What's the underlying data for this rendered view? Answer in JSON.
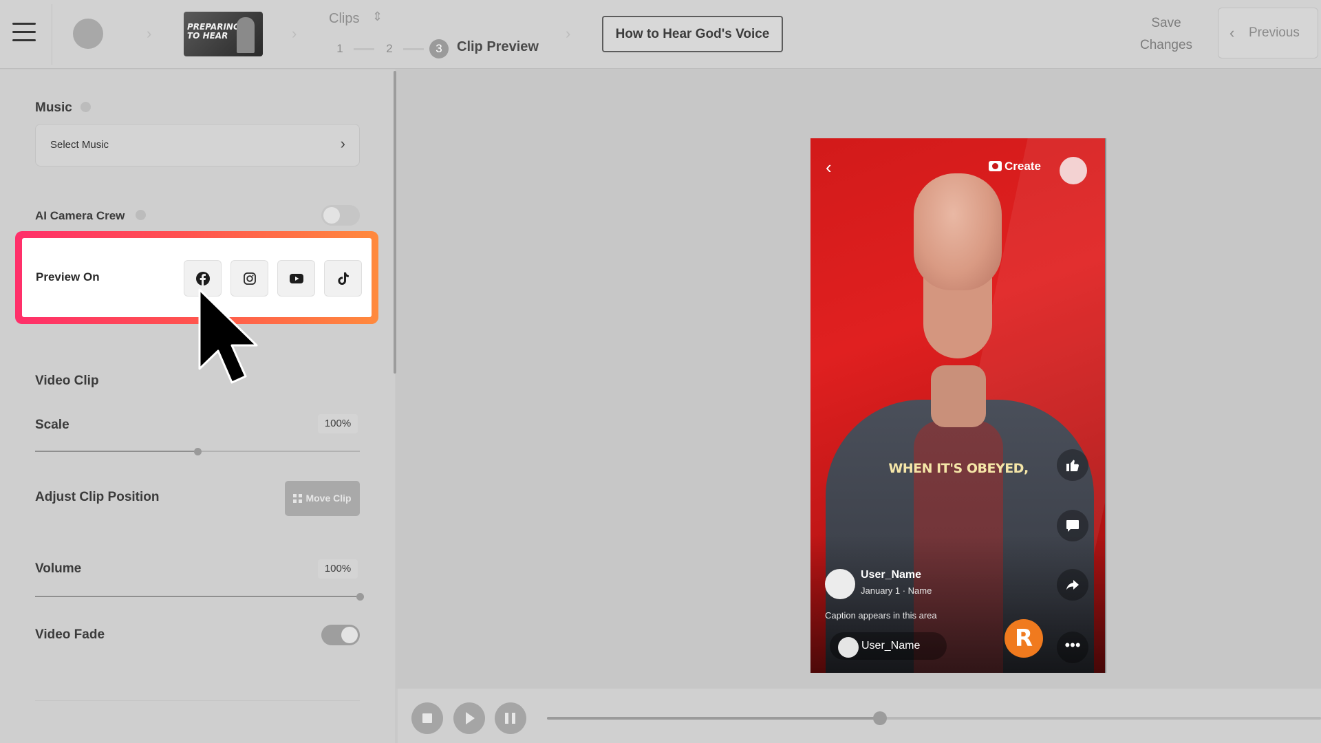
{
  "header": {
    "thumbnail_text": "PREPARING TO HEAR",
    "clips_label": "Clips",
    "steps": [
      {
        "number": "1",
        "label": ""
      },
      {
        "number": "2",
        "label": ""
      },
      {
        "number": "3",
        "label": "Clip Preview"
      }
    ],
    "title_button": "How to Hear God's Voice",
    "save_line1": "Save",
    "save_line2": "Changes",
    "previous_label": "Previous"
  },
  "sidebar": {
    "music_label": "Music",
    "select_music": "Select Music",
    "ai_camera_label": "AI Camera Crew",
    "ai_camera_on": false,
    "preview_on_label": "Preview On",
    "preview_platforms": [
      "facebook",
      "instagram",
      "youtube",
      "tiktok"
    ],
    "video_clip_label": "Video Clip",
    "scale_label": "Scale",
    "scale_value": "100%",
    "scale_level": 0.5,
    "adjust_position_label": "Adjust Clip Position",
    "move_clip_label": "Move Clip",
    "volume_label": "Volume",
    "volume_value": "100%",
    "volume_level": 1.0,
    "video_fade_label": "Video Fade",
    "video_fade_on": true
  },
  "phone": {
    "create_label": "Create",
    "caption_overlay": "WHEN IT'S OBEYED,",
    "username": "User_Name",
    "date_line": "January 1 · Name",
    "caption_placeholder": "Caption appears in this area",
    "pill_username": "User_Name",
    "logo_letter": "R",
    "more_label": "•••",
    "accent_color": "#e01f1f",
    "logo_color": "#f07a1e"
  },
  "player": {
    "progress": 0.43
  }
}
